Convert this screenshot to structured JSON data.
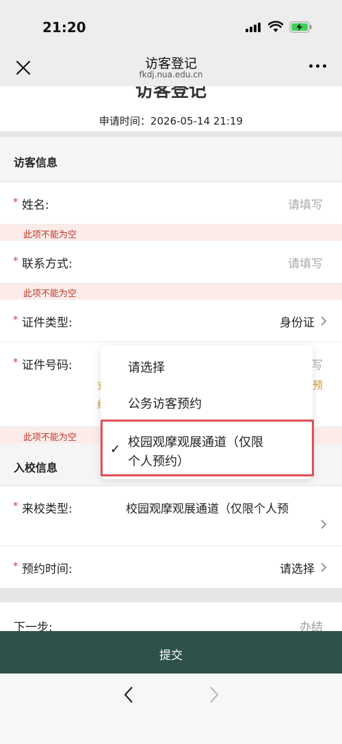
{
  "status_bar": {
    "time": "21:20",
    "icons": [
      "signal-icon",
      "wifi-icon",
      "battery-charging-icon"
    ]
  },
  "nav_bar": {
    "title": "访客登记",
    "url": "fkdj.nua.edu.cn",
    "left_icon": "close-icon",
    "right_icon": "more-icon"
  },
  "hero": {
    "title": "访客登记",
    "apply_time_label": "申请时间：",
    "apply_time_value": "2026-05-14 21:19"
  },
  "visitor_info": {
    "section_title": "访客信息",
    "name": {
      "required_mark": "*",
      "label": "姓名:",
      "placeholder": "请填写",
      "error": "此项不能为空"
    },
    "phone": {
      "required_mark": "*",
      "label": "联系方式:",
      "placeholder": "请填写",
      "error": "此项不能为空"
    },
    "id_type": {
      "required_mark": "*",
      "label": "证件类型:",
      "value": "身份证"
    },
    "id_number": {
      "required_mark": "*",
      "label": "证件号码:",
      "placeholder_fragment": "写",
      "hint_fragment_1": "预",
      "hint_fragment_2": "式",
      "hint_fragment_3": "约",
      "error": "此项不能为空"
    }
  },
  "school_entry": {
    "section_title": "入校信息",
    "visit_type": {
      "required_mark": "*",
      "label": "来校类型:",
      "value": "校园观摩观展通道（仅限个人预"
    },
    "appointment_time": {
      "required_mark": "*",
      "label": "预约时间:",
      "value": "请选择"
    }
  },
  "next_step": {
    "label": "下一步:",
    "value": "办结"
  },
  "submit": {
    "label": "提交"
  },
  "dropdown": {
    "options": [
      {
        "label": "请选择",
        "selected": false
      },
      {
        "label": "公务访客预约",
        "selected": false
      },
      {
        "label_line1": "校园观摩观展通道（仅限",
        "label_line2": "个人预约）",
        "selected": true
      }
    ],
    "check_mark": "✓",
    "highlight_color": "#e24d55"
  },
  "colors": {
    "accent": "#2e5249",
    "required": "#e04040",
    "error_text": "#c0392b",
    "error_bg": "#fbecea"
  }
}
